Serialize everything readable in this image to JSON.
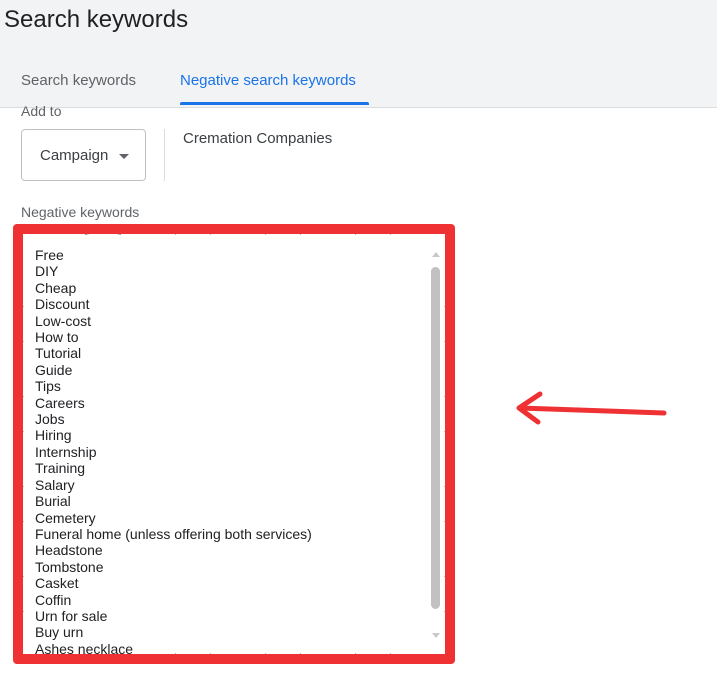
{
  "header": {
    "title": "Search keywords",
    "tabs": [
      {
        "label": "Search keywords",
        "active": false
      },
      {
        "label": "Negative search keywords",
        "active": true
      }
    ]
  },
  "form": {
    "add_to_label": "Add to",
    "level_select": {
      "value": "Campaign"
    },
    "campaign_name": "Cremation Companies",
    "negative_keywords_label": "Negative keywords",
    "negative_keywords": [
      "Free",
      "DIY",
      "Cheap",
      "Discount",
      "Low-cost",
      "How to",
      "Tutorial",
      "Guide",
      "Tips",
      "Careers",
      "Jobs",
      "Hiring",
      "Internship",
      "Training",
      "Salary",
      "Burial",
      "Cemetery",
      "Funeral home (unless offering both services)",
      "Headstone",
      "Tombstone",
      "Casket",
      "Coffin",
      "Urn for sale",
      "Buy urn",
      "Ashes necklace"
    ]
  },
  "annotation": {
    "highlight_color": "#f03134",
    "arrow_color": "#f03134",
    "arrow_direction": "left"
  },
  "colors": {
    "accent": "#1a73e8",
    "header_bg": "#f1f3f4"
  }
}
